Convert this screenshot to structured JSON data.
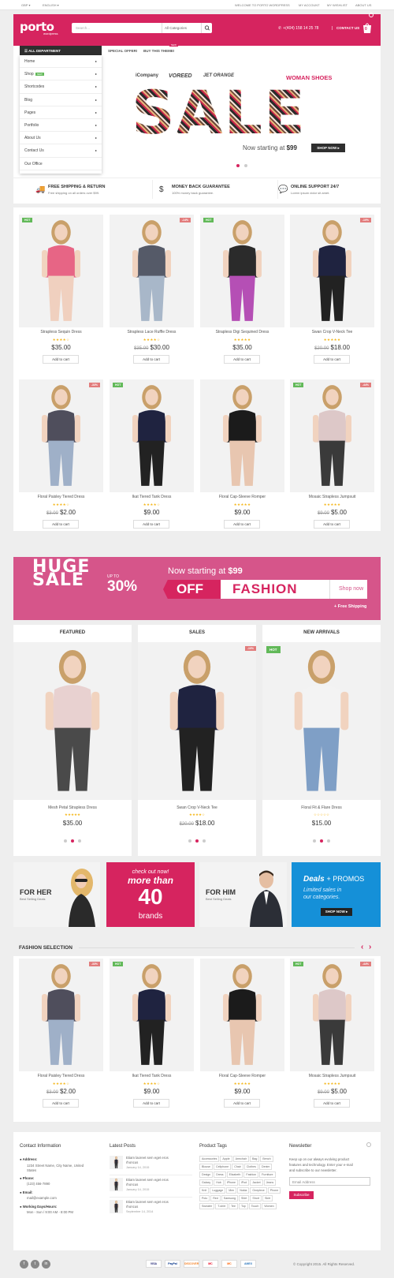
{
  "topbar": {
    "currency": "GBP ▾",
    "language": "ENGLISH ▾",
    "welcome": "WELCOME TO PORTO WORDPRESS",
    "my_account": "MY ACCOUNT",
    "my_wishlist": "MY WISHLIST",
    "about_us": "ABOUT US"
  },
  "header": {
    "logo": "porto",
    "logo_sub": "wordpress",
    "search_placeholder": "Search...",
    "search_category": "All Categories",
    "phone": "+(404) 158 14 25 78",
    "contact": "CONTACT US",
    "cart_count": "0",
    "brand_color": "#d6245f"
  },
  "nav": {
    "all_department": "ALL DEPARTMENT",
    "special_offer": "SPECIAL OFFER!",
    "buy_theme": "BUY THIS THEME!",
    "buy_badge": "NEW",
    "menu": [
      {
        "label": "Home",
        "arrow": "▸"
      },
      {
        "label": "Shop",
        "badge": "NEW",
        "arrow": "▸"
      },
      {
        "label": "Shortcodes",
        "arrow": "▸"
      },
      {
        "label": "Blog",
        "arrow": "▸"
      },
      {
        "label": "Pages",
        "arrow": "▸"
      },
      {
        "label": "Portfolio",
        "arrow": "▸"
      },
      {
        "label": "About Us",
        "arrow": "▸"
      },
      {
        "label": "Contact Us",
        "arrow": "▸"
      },
      {
        "label": "Our Office",
        "arrow": ""
      }
    ]
  },
  "hero": {
    "brand1": "iCompany",
    "brand2": "VOREED",
    "brand3": "JET ORANGE",
    "woman_shoes": "WOMAN SHOES",
    "sale": "SALE",
    "starting_prefix": "Now starting at ",
    "starting_price": "$99",
    "shop_now": "SHOP NOW ▸"
  },
  "features": [
    {
      "icon": "truck-icon",
      "glyph": "🚚",
      "title": "FREE SHIPPING & RETURN",
      "sub": "Free shipping on all orders over $99."
    },
    {
      "icon": "dollar-icon",
      "glyph": "$",
      "title": "MONEY BACK GUARANTEE",
      "sub": "100% money back guarantee."
    },
    {
      "icon": "chat-icon",
      "glyph": "💬",
      "title": "ONLINE SUPPORT 24/7",
      "sub": "Lorem ipsum dolor sit amet."
    }
  ],
  "products": [
    {
      "name": "Strapless Sequin Dress",
      "old": "",
      "price": "$35.00",
      "badge": "HOT",
      "disc": "",
      "stars": "★★★★☆",
      "color": "#e76585",
      "legs": "#f0d0bf"
    },
    {
      "name": "Strapless Lace Ruffle Dress",
      "old": "$35.00",
      "price": "$30.00",
      "badge": "",
      "disc": "-14%",
      "stars": "★★★★☆",
      "color": "#555a68",
      "legs": "#a8b7c9"
    },
    {
      "name": "Strapless Digi Sequined Dress",
      "old": "",
      "price": "$35.00",
      "badge": "HOT",
      "disc": "",
      "stars": "★★★★★",
      "color": "#2b2b2b",
      "legs": "#b54fb5"
    },
    {
      "name": "Swan Crop V-Neck Tee",
      "old": "$20.00",
      "price": "$18.00",
      "badge": "",
      "disc": "-10%",
      "stars": "★★★★★",
      "color": "#1f2340",
      "legs": "#222222"
    },
    {
      "name": "Floral Paisley Tiered Dress",
      "old": "$3.00",
      "price": "$2.00",
      "badge": "",
      "disc": "-33%",
      "stars": "★★★★☆",
      "color": "#4f4e5c",
      "legs": "#9fb0c8"
    },
    {
      "name": "Ikat Tiered Tank Dress",
      "old": "",
      "price": "$9.00",
      "badge": "HOT",
      "disc": "",
      "stars": "★★★★☆",
      "color": "#1f2340",
      "legs": "#222222"
    },
    {
      "name": "Floral Cap-Sleeve Romper",
      "old": "",
      "price": "$9.00",
      "badge": "",
      "disc": "",
      "stars": "★★★★★",
      "color": "#1b1b1b",
      "legs": "#e8c6b0"
    },
    {
      "name": "Mosaic Strapless Jumpsuit",
      "old": "$9.00",
      "price": "$5.00",
      "badge": "HOT",
      "disc": "-44%",
      "stars": "★★★★★",
      "color": "#ddc8c8",
      "legs": "#3a3a3a"
    }
  ],
  "add_to_cart": "Add to cart",
  "promo": {
    "huge": "HUGE",
    "sale": "SALE",
    "up_to": "UP TO",
    "percent": "30%",
    "starting_prefix": "Now starting at ",
    "starting_price": "$99",
    "off": "OFF",
    "fashion": "FASHION",
    "shop_now": "Shop now",
    "free_shipping": "+ Free Shipping"
  },
  "featured_cols": [
    {
      "title": "FEATURED",
      "name": "Mesh Petal Strapless Dress",
      "old": "",
      "price": "$35.00",
      "stars": "★★★★★",
      "badge": "",
      "disc": "",
      "color": "#e8d1d0",
      "legs": "#4a4a4a"
    },
    {
      "title": "SALES",
      "name": "Swan Crop V-Neck Tee",
      "old": "$20.00",
      "price": "$18.00",
      "stars": "★★★★☆",
      "badge": "",
      "disc": "-10%",
      "color": "#1f2340",
      "legs": "#222222"
    },
    {
      "title": "NEW ARRIVALS",
      "name": "Floral Fit & Flare Dress",
      "old": "",
      "price": "$15.00",
      "stars": "☆☆☆☆☆",
      "badge": "HOT",
      "disc": "",
      "color": "#f3f3f3",
      "legs": "#7f9fc6"
    }
  ],
  "tiles": {
    "for_her": "FOR HER",
    "for_her_sub": "Best Selling Deals",
    "check_out": "check out now!",
    "more_than": "more than",
    "forty": "40",
    "brands": "brands",
    "for_him": "FOR HIM",
    "for_him_sub": "Best Selling Deals",
    "deals": "Deals",
    "promos": "+ PROMOS",
    "limited": "Limited sales in",
    "limited2": "our categories.",
    "shop_now": "SHOP NOW ▸"
  },
  "fashion_selection": {
    "title": "FASHION SELECTION",
    "prev": "‹",
    "next": "›"
  },
  "footer": {
    "contact_title": "Contact Information",
    "address_label": "Address:",
    "address": "1234 Street Name, City Name, United States",
    "address1": "1234 Street Name, City Name, United",
    "address2": "States",
    "phone_label": "Phone:",
    "phone": "(123) 456-7890",
    "email_label": "Email:",
    "email": "mail@example.com",
    "hours_label": "Working Days/Hours:",
    "hours": "Mon - Sun / 9:00 AM - 8:00 PM",
    "posts_title": "Latest Posts",
    "posts": [
      {
        "t1": "Etiam laoreet sem eget eros",
        "t2": "rhoncus",
        "date": "January 14, 2015"
      },
      {
        "t1": "Etiam laoreet sem eget eros",
        "t2": "rhoncus",
        "date": "January 14, 2015"
      },
      {
        "t1": "Etiam laoreet sem eget eros",
        "t2": "rhoncus",
        "date": "September 14, 2014"
      }
    ],
    "tags_title": "Product Tags",
    "tags": [
      "Accessories",
      "Apple",
      "Armchair",
      "Bag",
      "Bench",
      "Blouse",
      "Cellphone",
      "Chair",
      "Clothes",
      "Denim",
      "Design",
      "Dress",
      "Elizabeth",
      "Fashion",
      "Furniture",
      "Galaxy",
      "Hub",
      "iPhone",
      "iPod",
      "Jacket",
      "Jeans",
      "Knit",
      "Luggage",
      "Men",
      "Nokia",
      "Oneplece",
      "Phone",
      "Polo",
      "Red",
      "Samsung",
      "Shirt",
      "Short",
      "Skirt",
      "Sweater",
      "T-shirt",
      "Tee",
      "Top",
      "Touch",
      "Women"
    ],
    "newsletter_title": "Newsletter",
    "newsletter_text1": "Keep up on our always evolving product",
    "newsletter_text2": "features and technology. Enter your e-mail",
    "newsletter_text3": "and subscribe to our newsletter.",
    "email_placeholder": "Email Address",
    "subscribe": "Subscribe"
  },
  "bottom": {
    "social": [
      "f",
      "t",
      "in"
    ],
    "payments": [
      "VISA",
      "PayPal",
      "DISCOVER",
      "MC",
      "MC",
      "AMEX"
    ],
    "copyright": "© Copyright 2015. All Rights Reserved."
  }
}
